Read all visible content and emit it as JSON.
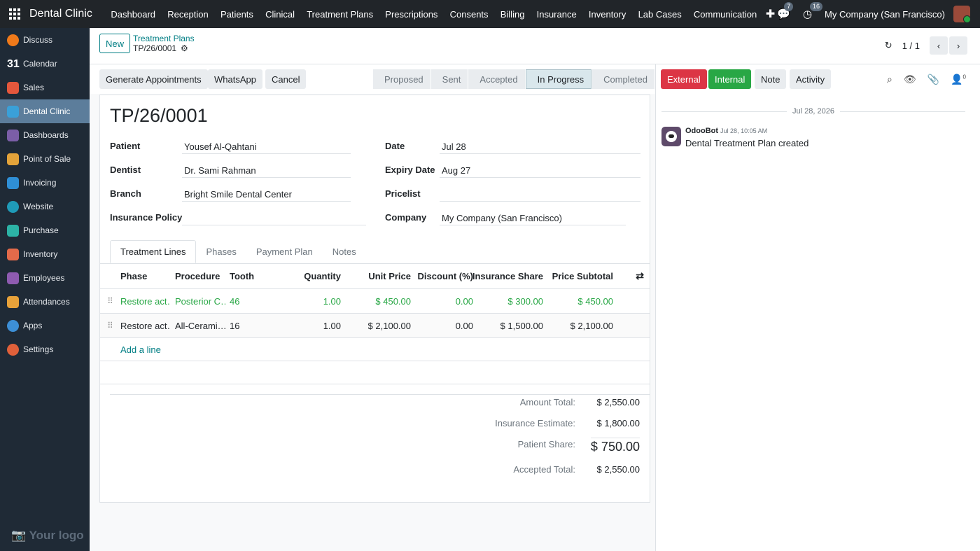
{
  "topbar": {
    "app_name": "Dental Clinic",
    "menu": [
      "Dashboard",
      "Reception",
      "Patients",
      "Clinical",
      "Treatment Plans",
      "Prescriptions",
      "Consents",
      "Billing",
      "Insurance",
      "Inventory",
      "Lab Cases",
      "Communication"
    ],
    "messages_count": "7",
    "activities_count": "16",
    "company": "My Company (San Francisco)"
  },
  "sidebar": {
    "items": [
      {
        "label": "Discuss",
        "color": "#f07a1a"
      },
      {
        "label": "Calendar",
        "color": "#1f2a36"
      },
      {
        "label": "Sales",
        "color": "#e4573c"
      },
      {
        "label": "Dental Clinic",
        "color": "#3aa0d8"
      },
      {
        "label": "Dashboards",
        "color": "#7b5ea7"
      },
      {
        "label": "Point of Sale",
        "color": "#e3a33a"
      },
      {
        "label": "Invoicing",
        "color": "#2f8fd6"
      },
      {
        "label": "Website",
        "color": "#1f9bb8"
      },
      {
        "label": "Purchase",
        "color": "#2cb3a6"
      },
      {
        "label": "Inventory",
        "color": "#e36a4a"
      },
      {
        "label": "Employees",
        "color": "#8e5bb0"
      },
      {
        "label": "Attendances",
        "color": "#e8a23a"
      },
      {
        "label": "Apps",
        "color": "#3d8fd6"
      },
      {
        "label": "Settings",
        "color": "#e0603a"
      }
    ],
    "logo": "Your logo"
  },
  "control": {
    "new_label": "New",
    "breadcrumb_parent": "Treatment Plans",
    "breadcrumb_current": "TP/26/0001",
    "pager": "1 / 1"
  },
  "statusbar": {
    "buttons": [
      "Generate Appointments",
      "WhatsApp",
      "Cancel"
    ],
    "stages": [
      "Proposed",
      "Sent",
      "Accepted",
      "In Progress",
      "Completed"
    ],
    "current_stage": "In Progress"
  },
  "form": {
    "title": "TP/26/0001",
    "patient_label": "Patient",
    "patient": "Yousef Al-Qahtani",
    "dentist_label": "Dentist",
    "dentist": "Dr. Sami Rahman",
    "branch_label": "Branch",
    "branch": "Bright Smile Dental Center",
    "insurance_label": "Insurance Policy",
    "insurance": "",
    "date_label": "Date",
    "date": "Jul 28",
    "expiry_label": "Expiry Date",
    "expiry": "Aug 27",
    "pricelist_label": "Pricelist",
    "pricelist": "",
    "company_label": "Company",
    "company": "My Company (San Francisco)"
  },
  "tabs": [
    "Treatment Lines",
    "Phases",
    "Payment Plan",
    "Notes"
  ],
  "table": {
    "headers": [
      "Phase",
      "Procedure",
      "Tooth",
      "Quantity",
      "Unit Price",
      "Discount (%)",
      "Insurance Share",
      "Price Subtotal"
    ],
    "rows": [
      [
        "Restore act…",
        "Posterior C…",
        "46",
        "1.00",
        "$ 450.00",
        "0.00",
        "$ 300.00",
        "$ 450.00"
      ],
      [
        "Restore act…",
        "All-Cerami…",
        "16",
        "1.00",
        "$ 2,100.00",
        "0.00",
        "$ 1,500.00",
        "$ 2,100.00"
      ]
    ],
    "add_line": "Add a line"
  },
  "totals": {
    "amount_label": "Amount Total:",
    "amount": "$ 2,550.00",
    "insurance_label": "Insurance Estimate:",
    "insurance": "$ 1,800.00",
    "patient_label": "Patient Share:",
    "patient": "$ 750.00",
    "accepted_label": "Accepted Total:",
    "accepted": "$ 2,550.00"
  },
  "chatter": {
    "buttons": [
      "External",
      "Internal",
      "Note",
      "Activity"
    ],
    "followers_count": "0",
    "date": "Jul 28, 2026",
    "author": "OdooBot",
    "time": "Jul 28, 10:05 AM",
    "body": "Dental Treatment Plan created"
  }
}
